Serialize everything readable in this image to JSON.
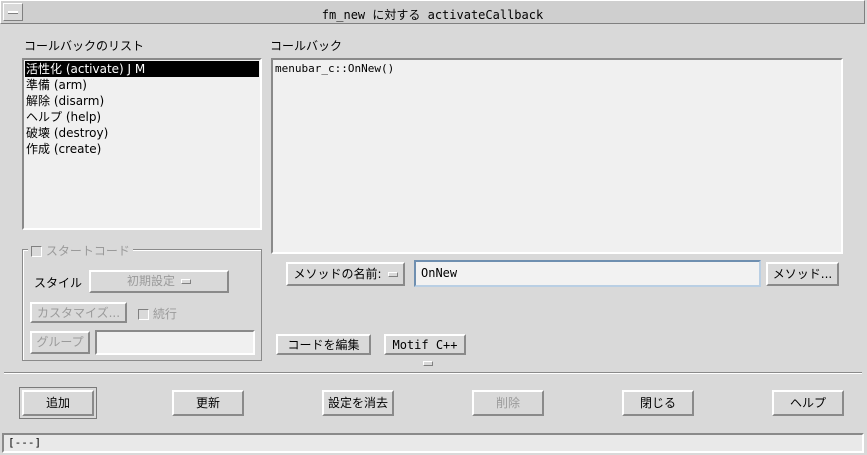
{
  "window": {
    "title": "fm_new に対する activateCallback"
  },
  "callback_list": {
    "label": "コールバックのリスト",
    "items": [
      "活性化 (activate) J M",
      "準備 (arm)",
      "解除 (disarm)",
      "ヘルプ (help)",
      "破壊 (destroy)",
      "作成 (create)"
    ]
  },
  "callback": {
    "label": "コールバック",
    "text": "menubar_c::OnNew()"
  },
  "start_code": {
    "label": "スタートコード",
    "style_label": "スタイル",
    "style_value": "初期設定",
    "customize_label": "カスタマイズ...",
    "run_label": "続行",
    "group_label": "グループ",
    "group_value": ""
  },
  "method": {
    "name_label": "メソッドの名前:",
    "name_value": "OnNew",
    "method_button": "メソッド..."
  },
  "code": {
    "edit_label": "コードを編集",
    "language": "Motif C++"
  },
  "buttons": {
    "add": "追加",
    "update": "更新",
    "clear": "設定を消去",
    "delete": "削除",
    "close": "閉じる",
    "help": "ヘルプ"
  },
  "status": {
    "text": "[---]"
  }
}
